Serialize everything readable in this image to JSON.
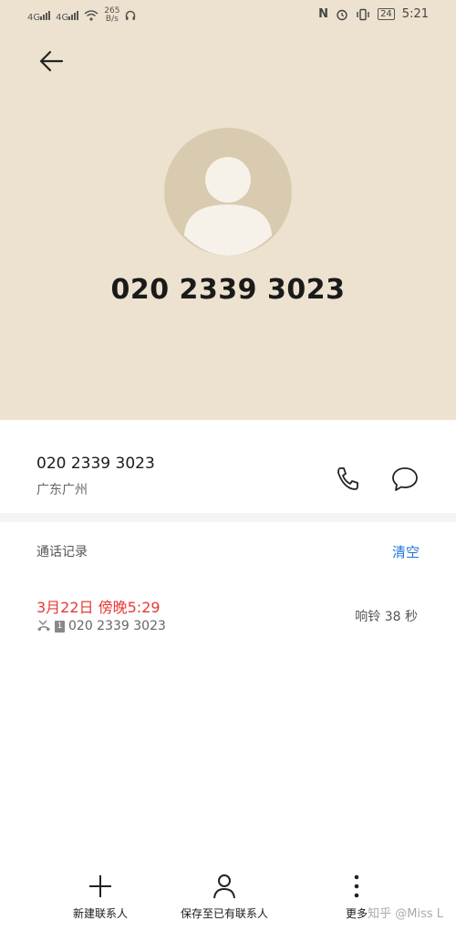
{
  "status_bar": {
    "left": {
      "sig1": "4G",
      "sig2": "4G",
      "speed_value": "265",
      "speed_unit": "B/s"
    },
    "right": {
      "nfc_label": "N",
      "battery": "24",
      "time": "5:21"
    }
  },
  "header": {
    "back_icon": "arrow-left-icon"
  },
  "contact": {
    "avatar_icon": "person-silhouette-icon",
    "number": "020 2339 3023",
    "location": "广东广州"
  },
  "actions": {
    "call_icon": "phone-icon",
    "message_icon": "message-bubble-icon"
  },
  "call_log": {
    "title": "通话记录",
    "clear_label": "清空",
    "entries": [
      {
        "date": "3月22日 傍晚5:29",
        "number": "020 2339 3023",
        "sim": "1",
        "duration": "响铃 38 秒",
        "status_color": "#e53935"
      }
    ]
  },
  "bottom_bar": {
    "items": [
      {
        "label": "新建联系人",
        "icon": "plus-icon"
      },
      {
        "label": "保存至已有联系人",
        "icon": "person-icon"
      },
      {
        "label": "更多",
        "icon": "more-vertical-icon"
      }
    ]
  },
  "watermark": "知乎 @Miss L",
  "colors": {
    "hero_bg": "#ece2cf",
    "accent": "#1e73d8",
    "missed": "#e53935"
  }
}
